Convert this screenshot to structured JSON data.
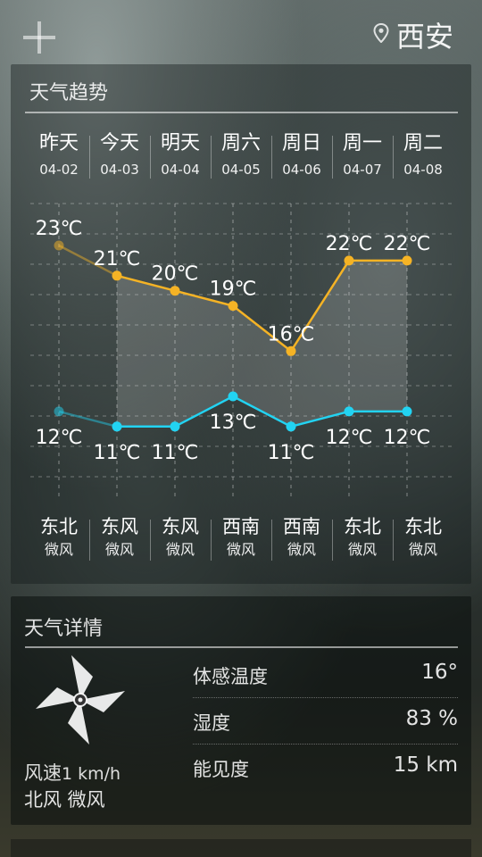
{
  "header": {
    "city": "西安"
  },
  "trend": {
    "title": "天气趋势",
    "days": [
      {
        "name": "昨天",
        "date": "04-02",
        "wind_dir": "东北",
        "wind_level": "微风"
      },
      {
        "name": "今天",
        "date": "04-03",
        "wind_dir": "东风",
        "wind_level": "微风"
      },
      {
        "name": "明天",
        "date": "04-04",
        "wind_dir": "东风",
        "wind_level": "微风"
      },
      {
        "name": "周六",
        "date": "04-05",
        "wind_dir": "西南",
        "wind_level": "微风"
      },
      {
        "name": "周日",
        "date": "04-06",
        "wind_dir": "西南",
        "wind_level": "微风"
      },
      {
        "name": "周一",
        "date": "04-07",
        "wind_dir": "东北",
        "wind_level": "微风"
      },
      {
        "name": "周二",
        "date": "04-08",
        "wind_dir": "东北",
        "wind_level": "微风"
      }
    ]
  },
  "chart_data": {
    "type": "line",
    "categories": [
      "04-02",
      "04-03",
      "04-04",
      "04-05",
      "04-06",
      "04-07",
      "04-08"
    ],
    "series": [
      {
        "values": [
          23,
          21,
          20,
          19,
          16,
          22,
          22
        ],
        "color": "#f5b325"
      },
      {
        "values": [
          12,
          11,
          11,
          13,
          11,
          12,
          12
        ],
        "color": "#22d3f2"
      }
    ],
    "unit": "℃",
    "grid": true
  },
  "details": {
    "title": "天气详情",
    "wind_speed_label": "风速",
    "wind_speed_value": "1 km/h",
    "wind_summary": "北风 微风",
    "rows": [
      {
        "label": "体感温度",
        "value": "16°"
      },
      {
        "label": "湿度",
        "value": "83 %"
      },
      {
        "label": "能见度",
        "value": "15 km"
      }
    ]
  }
}
